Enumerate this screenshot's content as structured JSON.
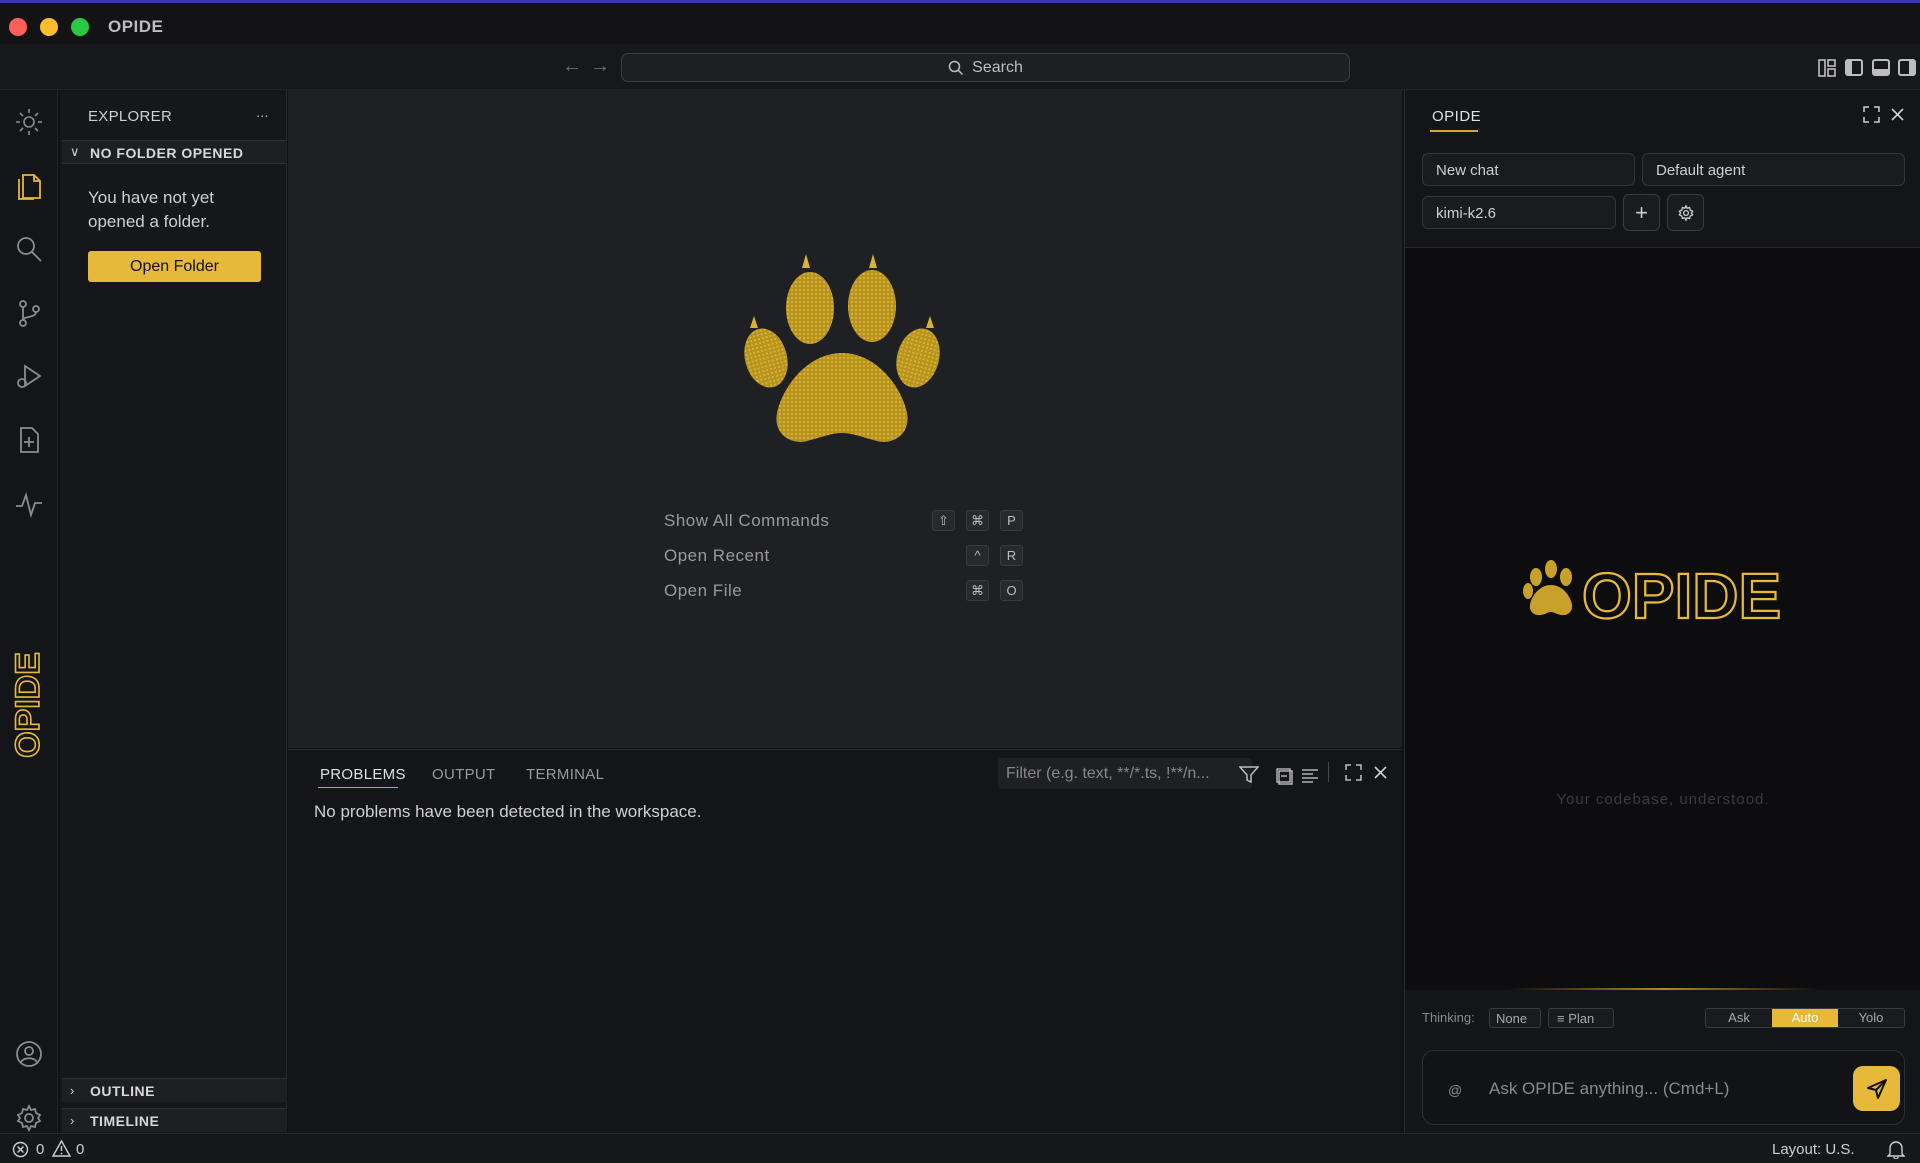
{
  "window": {
    "title": "OPIDE",
    "traffic_light_colors": {
      "close": "#fe5f57",
      "minimize": "#febc2e",
      "maximize": "#28c840"
    }
  },
  "toolbar": {
    "back_icon": "arrow-left-icon",
    "forward_icon": "arrow-right-icon",
    "search_label": "Search",
    "layout_icons": [
      "customize-layout-icon",
      "toggle-primary-sidebar-icon",
      "toggle-panel-icon",
      "toggle-secondary-sidebar-icon"
    ]
  },
  "activity_bar": {
    "items": [
      {
        "name": "opide-sun-icon"
      },
      {
        "name": "explorer-files-icon",
        "active": true
      },
      {
        "name": "search-icon"
      },
      {
        "name": "source-control-icon"
      },
      {
        "name": "run-debug-icon"
      },
      {
        "name": "new-file-icon"
      },
      {
        "name": "activity-pulse-icon"
      }
    ],
    "brand_vertical": "OPIDE",
    "bottom_items": [
      {
        "name": "account-icon"
      },
      {
        "name": "settings-gear-icon"
      }
    ]
  },
  "explorer": {
    "title": "EXPLORER",
    "more_label": "...",
    "no_folder_section": "NO FOLDER OPENED",
    "message": "You have not yet opened a folder.",
    "open_folder_button": "Open Folder",
    "outline_section": "OUTLINE",
    "timeline_section": "TIMELINE"
  },
  "editor": {
    "watermark": "paw-logo",
    "commands": [
      {
        "label": "Show All Commands",
        "keys": [
          "⇧",
          "⌘",
          "P"
        ]
      },
      {
        "label": "Open Recent",
        "keys": [
          "^",
          "R"
        ]
      },
      {
        "label": "Open File",
        "keys": [
          "⌘",
          "O"
        ]
      }
    ]
  },
  "panel": {
    "tabs": {
      "problems": "PROBLEMS",
      "output": "OUTPUT",
      "terminal": "TERMINAL"
    },
    "active_tab": "PROBLEMS",
    "filter_placeholder": "Filter (e.g. text, **/*.ts, !**/n...",
    "message": "No problems have been detected in the workspace."
  },
  "chat": {
    "tab_label": "OPIDE",
    "new_chat": "New chat",
    "agent": "Default agent",
    "model": "kimi-k2.6",
    "brand_text": "OPIDE",
    "tagline": "Your codebase, understood.",
    "thinking_label": "Thinking:",
    "thinking_value": "None",
    "plan_label": "Plan",
    "modes": [
      "Ask",
      "Auto",
      "Yolo"
    ],
    "active_mode": "Auto",
    "mention_symbol": "@",
    "input_placeholder": "Ask OPIDE anything... (Cmd+L)"
  },
  "status_bar": {
    "errors": "0",
    "warnings": "0",
    "layout": "Layout: U.S."
  },
  "colors": {
    "accent": "#e6b93a",
    "background": "#1f2023",
    "chat_background": "#0d0d0f"
  }
}
